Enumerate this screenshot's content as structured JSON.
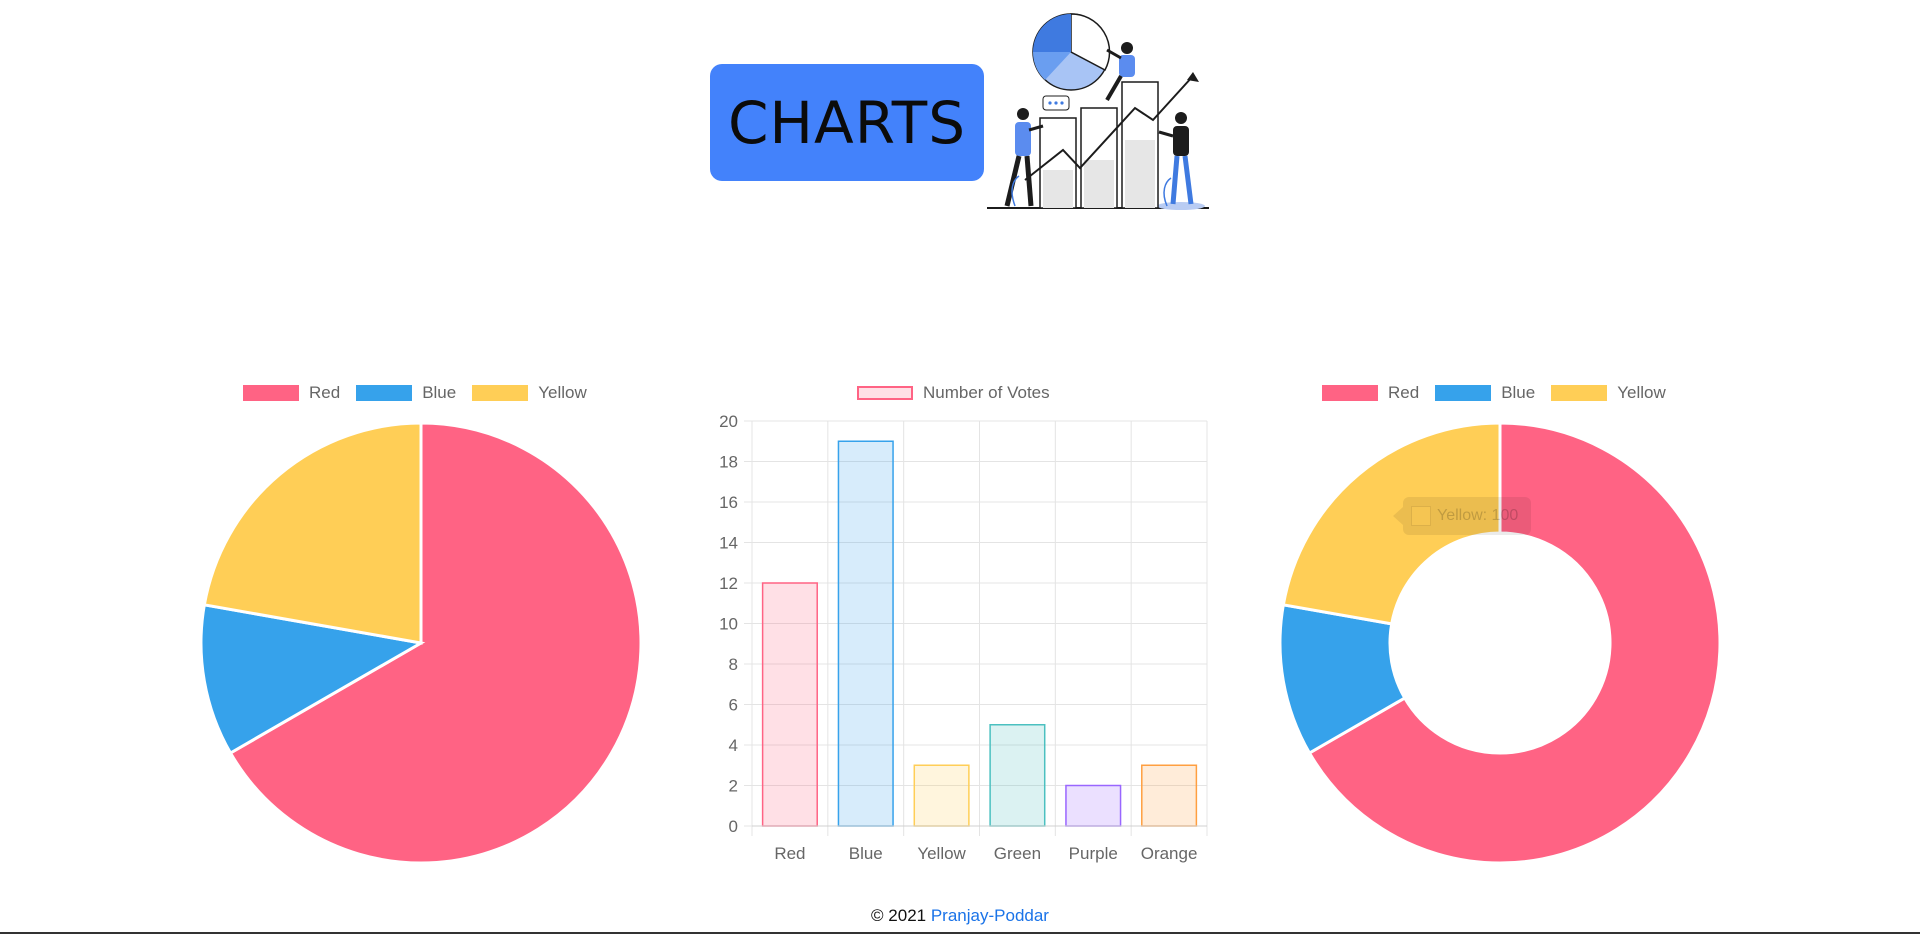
{
  "header": {
    "title": "CHARTS",
    "illustration": "people-with-charts-illustration"
  },
  "charts": {
    "pie": {
      "legend": [
        {
          "label": "Red",
          "color": "#ff6384"
        },
        {
          "label": "Blue",
          "color": "#36a2eb"
        },
        {
          "label": "Yellow",
          "color": "#ffce56"
        }
      ]
    },
    "bar": {
      "legend_label": "Number of Votes",
      "y_ticks": [
        "0",
        "2",
        "4",
        "6",
        "8",
        "10",
        "12",
        "14",
        "16",
        "18",
        "20"
      ]
    },
    "doughnut": {
      "legend": [
        {
          "label": "Red",
          "color": "#ff6384"
        },
        {
          "label": "Blue",
          "color": "#36a2eb"
        },
        {
          "label": "Yellow",
          "color": "#ffce56"
        }
      ],
      "tooltip": {
        "label": "Yellow: 100",
        "color": "#ffce56"
      }
    }
  },
  "chart_data": [
    {
      "type": "pie",
      "categories": [
        "Red",
        "Blue",
        "Yellow"
      ],
      "values": [
        300,
        50,
        100
      ],
      "colors": [
        "#ff6384",
        "#36a2eb",
        "#ffce56"
      ],
      "legend_position": "top"
    },
    {
      "type": "bar",
      "categories": [
        "Red",
        "Blue",
        "Yellow",
        "Green",
        "Purple",
        "Orange"
      ],
      "series": [
        {
          "name": "Number of Votes",
          "values": [
            12,
            19,
            3,
            5,
            2,
            3
          ]
        }
      ],
      "colors": [
        "#ff6384",
        "#36a2eb",
        "#ffce56",
        "#4bc0c0",
        "#9966ff",
        "#ff9f40"
      ],
      "ylim": [
        0,
        20
      ],
      "grid": true,
      "legend_position": "top"
    },
    {
      "type": "pie",
      "subtype": "doughnut",
      "categories": [
        "Red",
        "Blue",
        "Yellow"
      ],
      "values": [
        300,
        50,
        100
      ],
      "colors": [
        "#ff6384",
        "#36a2eb",
        "#ffce56"
      ],
      "legend_position": "top"
    }
  ],
  "footer": {
    "copyright": "© 2021",
    "author": "Pranjay-Poddar"
  }
}
